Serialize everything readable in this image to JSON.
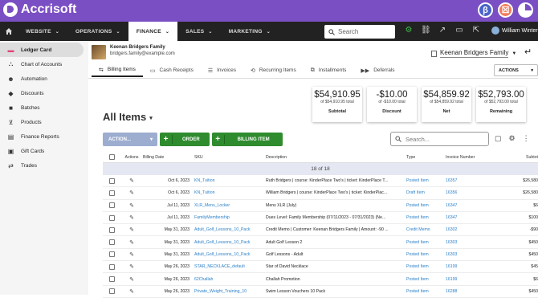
{
  "app": {
    "name": "Accrisoft"
  },
  "topbar": {
    "avatar_beta": "β",
    "avatar_alert": "☒"
  },
  "nav": {
    "items": [
      {
        "label": "WEBSITE"
      },
      {
        "label": "OPERATIONS"
      },
      {
        "label": "FINANCE"
      },
      {
        "label": "SALES"
      },
      {
        "label": "MARKETING"
      }
    ],
    "search_placeholder": "Search",
    "user_name": "William Winter"
  },
  "sidebar": {
    "items": [
      {
        "label": "Ledger Card",
        "icon": "ledger-icon"
      },
      {
        "label": "Chart of Accounts",
        "icon": "chart-icon"
      },
      {
        "label": "Automation",
        "icon": "robot-icon"
      },
      {
        "label": "Discounts",
        "icon": "tag-icon"
      },
      {
        "label": "Batches",
        "icon": "folder-icon"
      },
      {
        "label": "Products",
        "icon": "cart-icon"
      },
      {
        "label": "Finance Reports",
        "icon": "report-icon"
      },
      {
        "label": "Gift Cards",
        "icon": "gift-icon"
      },
      {
        "label": "Trades",
        "icon": "swap-icon"
      }
    ]
  },
  "customer": {
    "name": "Keenan Bridgers Family",
    "email": "bridgers.family@example.com",
    "family_select": "Keenan Bridgers Family"
  },
  "tabs": [
    {
      "label": "Billing Items"
    },
    {
      "label": "Cash Receipts"
    },
    {
      "label": "Invoices"
    },
    {
      "label": "Recurring Items"
    },
    {
      "label": "Installments"
    },
    {
      "label": "Deferrals"
    }
  ],
  "actions_label": "ACTIONS",
  "summary": [
    {
      "value": "$54,910.95",
      "sub": "of $54,910.95 total",
      "label": "Subtotal"
    },
    {
      "value": "-$10.00",
      "sub": "of -$10.00 total",
      "label": "Discount"
    },
    {
      "value": "$54,859.92",
      "sub": "of $54,859.92 total",
      "label": "Net"
    },
    {
      "value": "$52,793.00",
      "sub": "of $52,793.00 total",
      "label": "Remaining"
    }
  ],
  "list": {
    "title": "All Items",
    "action_label": "ACTION...",
    "order_label": "ORDER",
    "billing_item_label": "BILLING ITEM",
    "search_placeholder": "Search...",
    "count_text": "18 of 18",
    "headers": {
      "actions": "Actions",
      "billing_date": "Billing Date",
      "sku": "SKU",
      "description": "Description",
      "type": "Type",
      "invoice_number": "Invoice Number",
      "subtotal": "Subtot"
    },
    "rows": [
      {
        "date": "Oct 6, 2023",
        "sku": "KN_Tuition",
        "desc": "Ruth Bridgers | course: KinderPlace Two's | ticket: KinderPlace T...",
        "type": "Posted Item",
        "inv": "16357",
        "sub": "$26,580"
      },
      {
        "date": "Oct 6, 2023",
        "sku": "KN_Tuition",
        "desc": "William Bridgers | course: KinderPlace Two's | ticket: KinderPlac...",
        "type": "Draft Item",
        "inv": "16356",
        "sub": "$26,580"
      },
      {
        "date": "Jul 11, 2023",
        "sku": "XLR_Mens_Locker",
        "desc": "Mens XLR (July)",
        "type": "Posted Item",
        "inv": "16347",
        "sub": "$6"
      },
      {
        "date": "Jul 11, 2023",
        "sku": "FamilyMembership",
        "desc": "Dues Level: Family Membership (07/11/2023 - 07/31/2023) (Ne...",
        "type": "Posted Item",
        "inv": "16347",
        "sub": "$100"
      },
      {
        "date": "May 31, 2023",
        "sku": "Adult_Golf_Lessons_10_Pack",
        "desc": "Credit Memo | Customer: Keenan Bridgers Family | Amount: -90 ...",
        "type": "Credit Memo",
        "inv": "16302",
        "sub": "-$90"
      },
      {
        "date": "May 31, 2023",
        "sku": "Adult_Golf_Lessons_10_Pack",
        "desc": "Adult Golf Lesson 2",
        "type": "Posted Item",
        "inv": "16303",
        "sub": "$450"
      },
      {
        "date": "May 31, 2023",
        "sku": "Adult_Golf_Lessons_10_Pack",
        "desc": "Golf Lessons - Adult",
        "type": "Posted Item",
        "inv": "16303",
        "sub": "$450"
      },
      {
        "date": "May 26, 2023",
        "sku": "STAR_NECKLACE_default",
        "desc": "Star of David Necklace",
        "type": "Posted Item",
        "inv": "16199",
        "sub": "$45"
      },
      {
        "date": "May 26, 2023",
        "sku": "62Challah",
        "desc": "Challah Promotion",
        "type": "Posted Item",
        "inv": "16199",
        "sub": "$6"
      },
      {
        "date": "May 26, 2023",
        "sku": "Private_Weight_Training_10",
        "desc": "Swim Lesson Vouchers 10 Pack",
        "type": "Posted Item",
        "inv": "16288",
        "sub": "$450"
      }
    ]
  }
}
